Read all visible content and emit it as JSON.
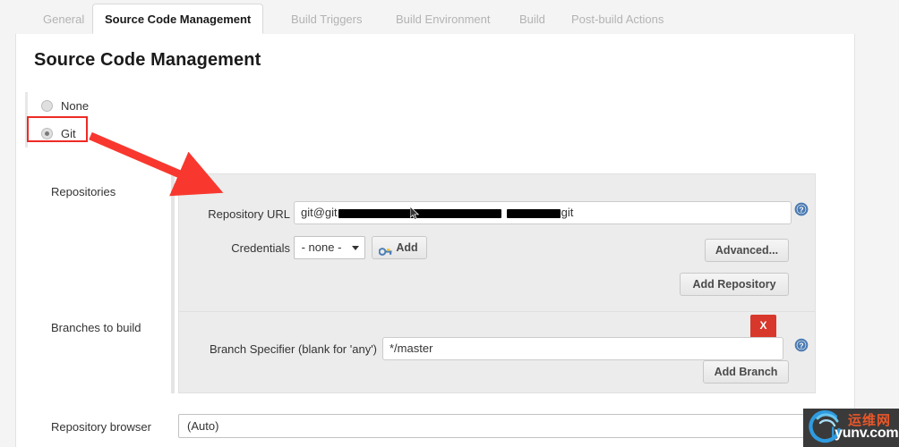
{
  "tabs": [
    {
      "label": "General",
      "active": false
    },
    {
      "label": "Source Code Management",
      "active": true
    },
    {
      "label": "Build Triggers",
      "active": false
    },
    {
      "label": "Build Environment",
      "active": false
    },
    {
      "label": "Build",
      "active": false
    },
    {
      "label": "Post-build Actions",
      "active": false
    }
  ],
  "section": {
    "title": "Source Code Management"
  },
  "scm": {
    "options": [
      {
        "label": "None",
        "selected": false
      },
      {
        "label": "Git",
        "selected": true
      }
    ]
  },
  "repositories": {
    "label": "Repositories",
    "url_label": "Repository URL",
    "url_value_prefix": "git@git",
    "url_value_suffix": "git",
    "credentials_label": "Credentials",
    "credentials_value": "- none -",
    "add_credentials_label": "Add",
    "advanced_label": "Advanced...",
    "add_repository_label": "Add Repository"
  },
  "branches": {
    "label": "Branches to build",
    "specifier_label": "Branch Specifier (blank for 'any')",
    "specifier_value": "*/master",
    "delete_label": "X",
    "add_branch_label": "Add Branch"
  },
  "repository_browser": {
    "label": "Repository browser",
    "value": "(Auto)"
  },
  "icons": {
    "help": "help-icon",
    "key": "key-icon",
    "caret": "chevron-down-icon",
    "arrow": "red-arrow-annotation",
    "cursor": "mouse-cursor"
  },
  "watermark": {
    "cn_text": "运维网",
    "domain": "lyunv.com",
    "domain_lead": "l"
  },
  "colors": {
    "accent_red": "#ee2a24",
    "delete_red": "#d8372b",
    "help_blue": "#3b6ea5",
    "panel_bg": "#ececec",
    "page_bg": "#f4f4f4"
  }
}
